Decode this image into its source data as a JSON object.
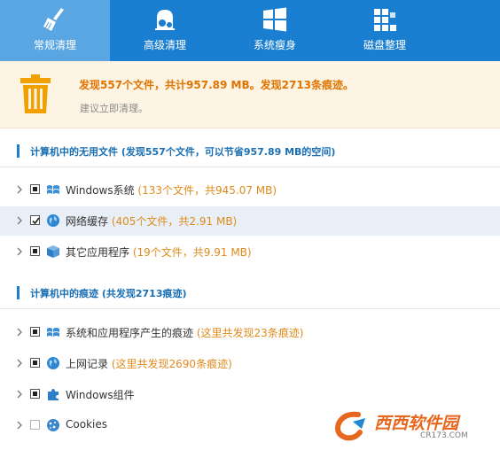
{
  "tabs": [
    {
      "label": "常规清理",
      "icon": "broom-icon",
      "active": true
    },
    {
      "label": "高级清理",
      "icon": "vacuum-icon",
      "active": false
    },
    {
      "label": "系统瘦身",
      "icon": "windows-icon",
      "active": false
    },
    {
      "label": "磁盘整理",
      "icon": "disk-defrag-icon",
      "active": false
    }
  ],
  "summary": {
    "headline": "发现557个文件，共计957.89 MB。发现2713条痕迹。",
    "suggestion": "建议立即清理。"
  },
  "sections": [
    {
      "title": "计算机中的无用文件 (发现557个文件，可以节省957.89 MB的空间)",
      "items": [
        {
          "label": "Windows系统",
          "note": "(133个文件，共945.07 MB)",
          "checked": "partial",
          "icon": "windows-logo-icon"
        },
        {
          "label": "网络缓存",
          "note": "(405个文件，共2.91 MB)",
          "checked": "checked",
          "icon": "globe-icon"
        },
        {
          "label": "其它应用程序",
          "note": "(19个文件，共9.91 MB)",
          "checked": "partial",
          "icon": "box-icon"
        }
      ]
    },
    {
      "title": "计算机中的痕迹 (共发现2713痕迹)",
      "items": [
        {
          "label": "系统和应用程序产生的痕迹",
          "note": "(这里共发现23条痕迹)",
          "checked": "partial",
          "icon": "windows-logo-icon"
        },
        {
          "label": "上网记录",
          "note": "(这里共发现2690条痕迹)",
          "checked": "partial",
          "icon": "globe-icon"
        },
        {
          "label": "Windows组件",
          "note": "",
          "checked": "partial",
          "icon": "puzzle-icon"
        },
        {
          "label": "Cookies",
          "note": "",
          "checked": "unchecked",
          "icon": "cookie-icon"
        }
      ]
    }
  ],
  "watermark": {
    "text": "西西软件园",
    "sub": "CR173.COM"
  },
  "colors": {
    "accent": "#1a7fd0",
    "active_tab": "#5aa6e3",
    "banner_bg": "#fdf4e3",
    "note": "#e08a1c",
    "headline": "#e07400"
  }
}
